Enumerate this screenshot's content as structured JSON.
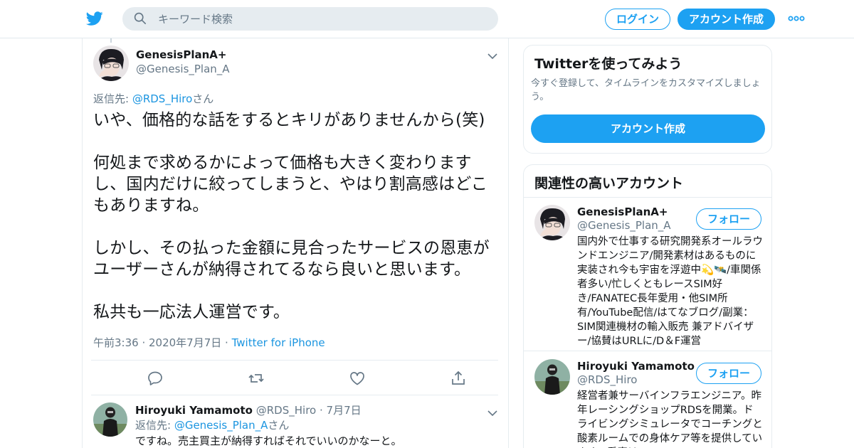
{
  "header": {
    "search_placeholder": "キーワード検索",
    "login_label": "ログイン",
    "signup_label": "アカウント作成",
    "icons": [
      "twitter-bird-icon",
      "search-icon",
      "more-dots-icon"
    ]
  },
  "tweet": {
    "author_name": "GenesisPlanA+",
    "author_handle": "@Genesis_Plan_A",
    "reply_prefix": "返信先: ",
    "reply_target": "@RDS_Hiro",
    "reply_suffix": "さん",
    "text": "いや、価格的な話をするとキリがありませんから(笑)\n\n何処まで求めるかによって価格も大きく変わります\nし、国内だけに絞ってしまうと、やはり割高感はどこ\nもありますね。\n\nしかし、その払った金額に見合ったサービスの恩恵が\nユーザーさんが納得されてるなら良いと思います。\n\n私共も一応法人運営です。",
    "time": "午前3:36",
    "date": "2020年7月7日",
    "source": "Twitter for iPhone",
    "actions": [
      "reply-icon",
      "retweet-icon",
      "like-icon",
      "share-icon"
    ]
  },
  "reply": {
    "author_name": "Hiroyuki Yamamoto",
    "author_handle": "@RDS_Hiro",
    "date": "7月7日",
    "reply_prefix": "返信先: ",
    "reply_target": "@Genesis_Plan_A",
    "reply_suffix": "さん",
    "text": "ですね。売主買主が納得すればそれでいいのかなーと。"
  },
  "sidebar": {
    "signup_card": {
      "title": "Twitterを使ってみよう",
      "subtitle": "今すぐ登録して、タイムラインをカスタマイズしましょう。",
      "button": "アカウント作成"
    },
    "related": {
      "title": "関連性の高いアカウント",
      "accounts": [
        {
          "name": "GenesisPlanA+",
          "handle": "@Genesis_Plan_A",
          "follow": "フォロー",
          "bio": "国内外で仕事する研究開発系オールラウンドエンジニア/開発素材はあるものに実装され今も宇宙を浮遊中💫🛰️/車関係者多い/忙しくともレースSIM好き/FANATEC長年愛用・他SIM所有/YouTube配信/はてなブログ/副業：SIM関連機材の輸入販売 兼アドバイザー/協賛はURLに/D＆F運営"
        },
        {
          "name": "Hiroyuki Yamamoto",
          "handle": "@RDS_Hiro",
          "follow": "フォロー",
          "bio": "経営者兼サーバインフラエンジニア。昨年レーシングショップRDSを開業。ドライビングシミュレータでコーチングと酸素ルームでの身体ケア等を提供しています。愛車は"
        }
      ]
    }
  },
  "colors": {
    "accent": "#1da1f2",
    "link": "#1b95e0",
    "muted": "#657786",
    "border": "#e6ecf0"
  }
}
